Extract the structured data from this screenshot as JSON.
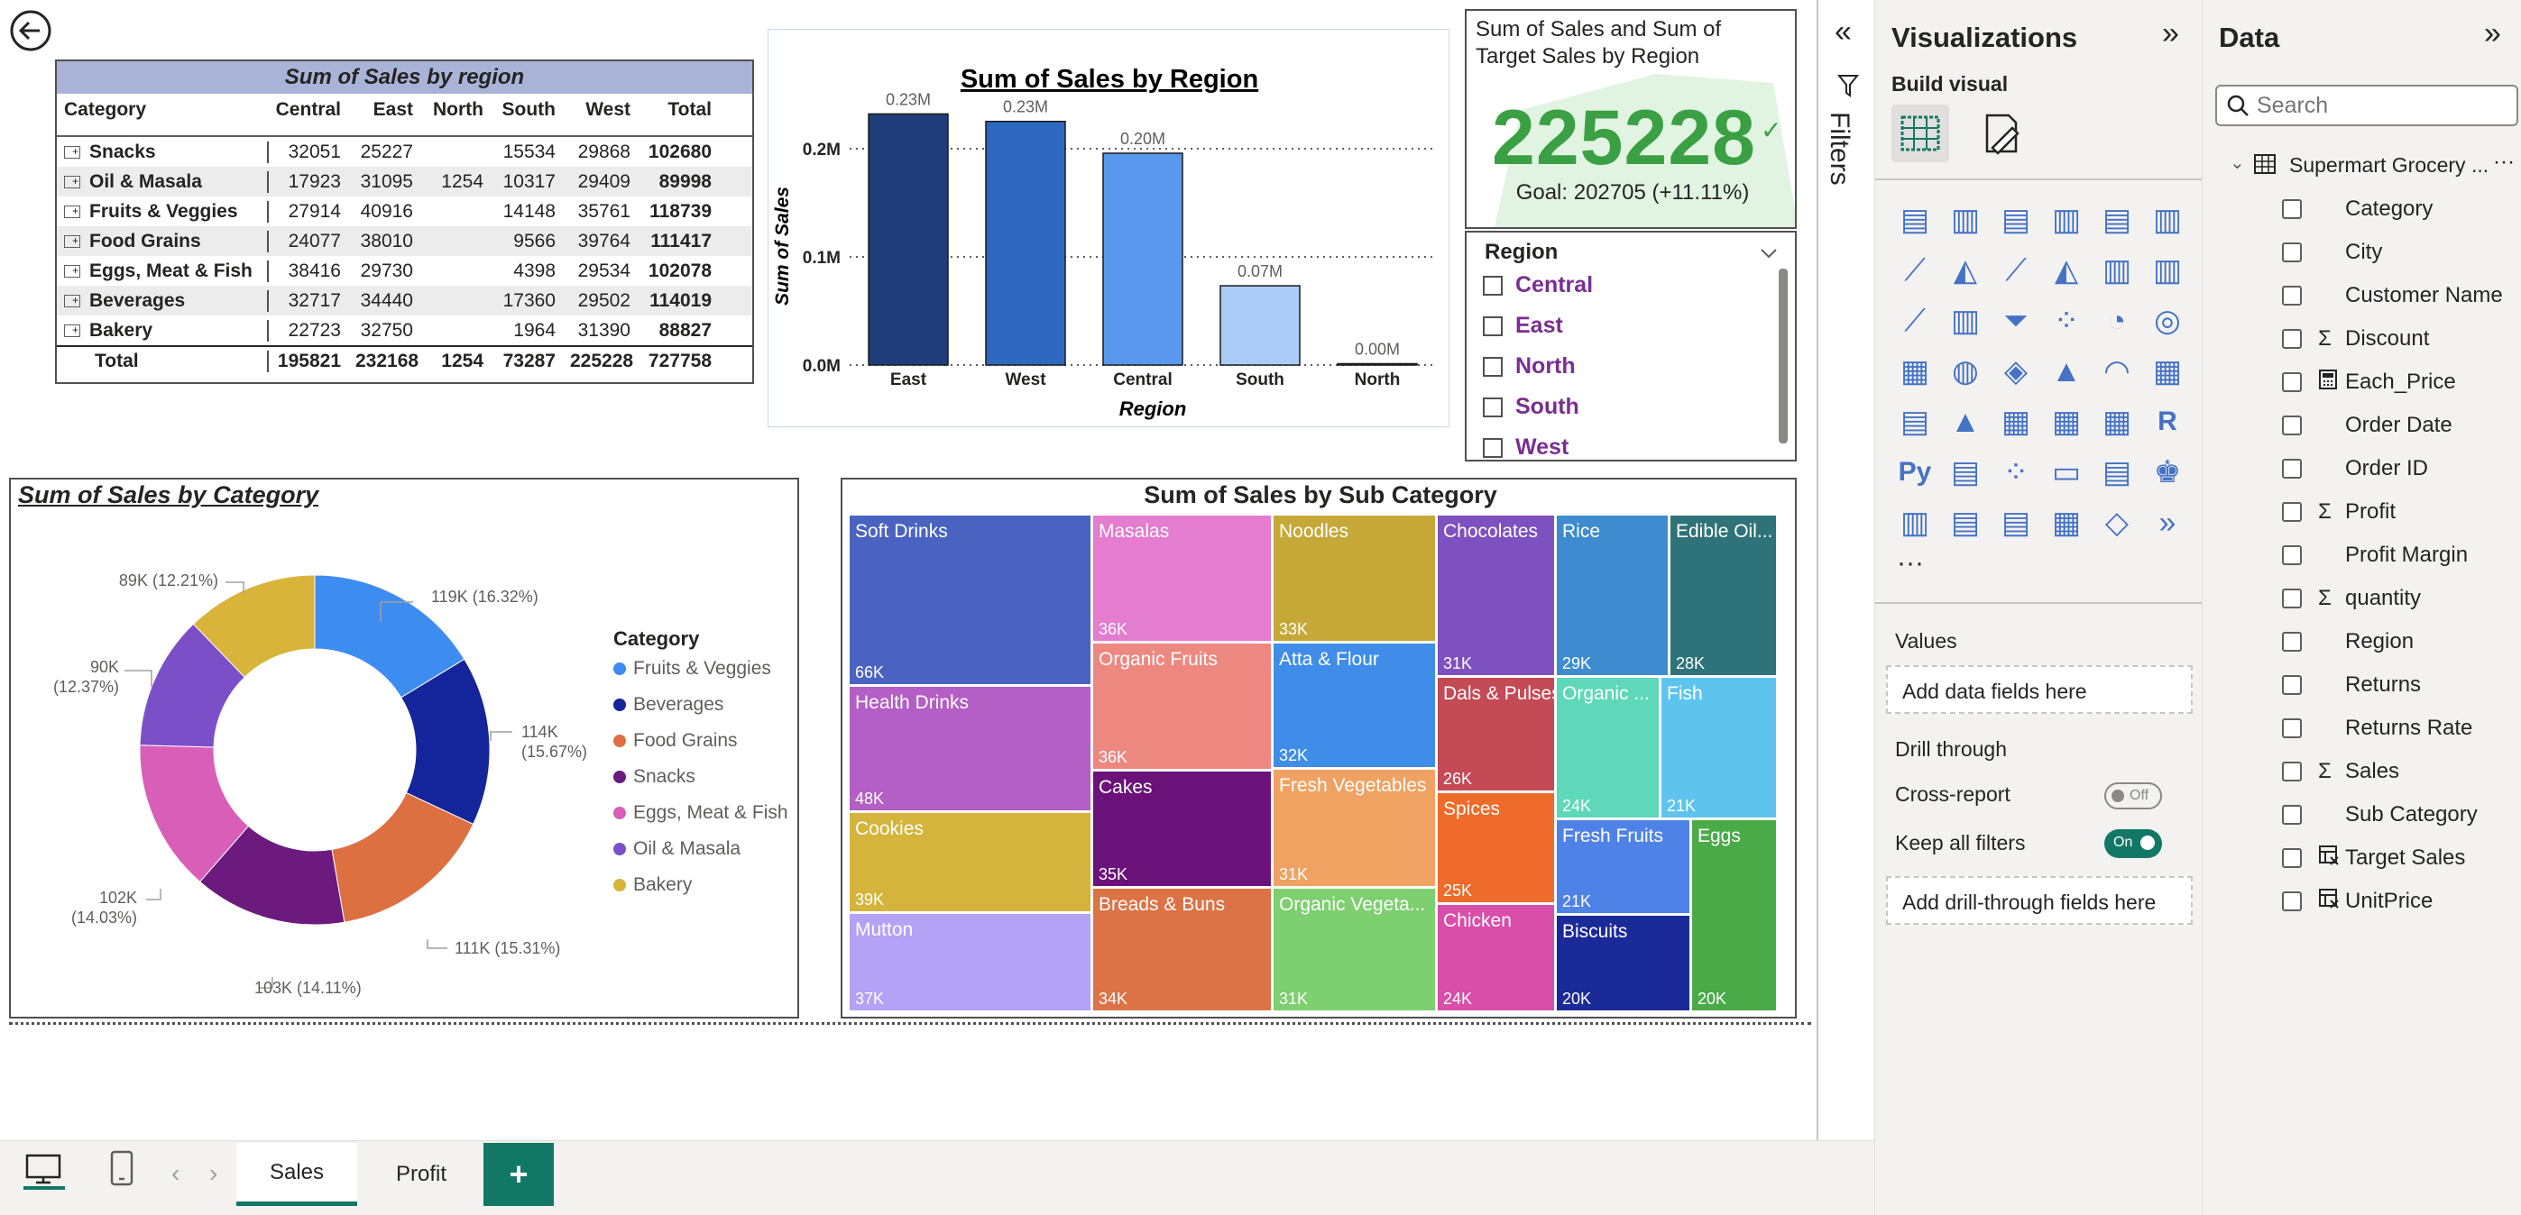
{
  "matrix": {
    "title": "Sum of Sales by region",
    "headers": [
      "Category",
      "Central",
      "East",
      "North",
      "South",
      "West",
      "Total"
    ],
    "rows": [
      [
        "Snacks",
        "32051",
        "25227",
        "",
        "15534",
        "29868",
        "102680"
      ],
      [
        "Oil & Masala",
        "17923",
        "31095",
        "1254",
        "10317",
        "29409",
        "89998"
      ],
      [
        "Fruits & Veggies",
        "27914",
        "40916",
        "",
        "14148",
        "35761",
        "118739"
      ],
      [
        "Food Grains",
        "24077",
        "38010",
        "",
        "9566",
        "39764",
        "111417"
      ],
      [
        "Eggs, Meat & Fish",
        "38416",
        "29730",
        "",
        "4398",
        "29534",
        "102078"
      ],
      [
        "Beverages",
        "32717",
        "34440",
        "",
        "17360",
        "29502",
        "114019"
      ],
      [
        "Bakery",
        "22723",
        "32750",
        "",
        "1964",
        "31390",
        "88827"
      ]
    ],
    "total": [
      "Total",
      "195821",
      "232168",
      "1254",
      "73287",
      "225228",
      "727758"
    ],
    "expand_symbol": "+"
  },
  "region_chart": {
    "title": "Sum of Sales by Region",
    "xlabel": "Region",
    "ylabel": "Sum of Sales",
    "yticks": [
      "0.0M",
      "0.1M",
      "0.2M"
    ]
  },
  "kpi": {
    "title": "Sum of Sales and Sum of Target Sales by Region",
    "value": "225228",
    "check": "✓",
    "goal": "Goal: 202705 (+11.11%)"
  },
  "slicer": {
    "title": "Region",
    "items": [
      "Central",
      "East",
      "North",
      "South",
      "West"
    ]
  },
  "category_chart": {
    "title": "Sum of Sales by Category",
    "legend_title": "Category",
    "labels": [
      "119K (16.32%)",
      "114K",
      "(15.67%)",
      "111K (15.31%)",
      "103K (14.11%)",
      "102K",
      "(14.03%)",
      "90K",
      "(12.37%)",
      "89K (12.21%)"
    ]
  },
  "treemap": {
    "title": "Sum of Sales by Sub Category",
    "cells": [
      {
        "name": "Soft Drinks",
        "value": "66K",
        "color": "#4b63c0"
      },
      {
        "name": "Health Drinks",
        "value": "48K",
        "color": "#b35fc5"
      },
      {
        "name": "Cookies",
        "value": "39K",
        "color": "#d4b43c"
      },
      {
        "name": "Mutton",
        "value": "37K",
        "color": "#b3a2f5"
      },
      {
        "name": "Masalas",
        "value": "36K",
        "color": "#e47ccf"
      },
      {
        "name": "Organic Fruits",
        "value": "36K",
        "color": "#ec8880"
      },
      {
        "name": "Cakes",
        "value": "35K",
        "color": "#6a1279"
      },
      {
        "name": "Breads & Buns",
        "value": "34K",
        "color": "#db7346"
      },
      {
        "name": "Noodles",
        "value": "33K",
        "color": "#c5a838"
      },
      {
        "name": "Atta & Flour",
        "value": "32K",
        "color": "#3f8de8"
      },
      {
        "name": "Fresh Vegetables",
        "value": "31K",
        "color": "#efa262"
      },
      {
        "name": "Organic Vegeta...",
        "value": "31K",
        "color": "#7ecf6f"
      },
      {
        "name": "Chocolates",
        "value": "31K",
        "color": "#7e51c0"
      },
      {
        "name": "Dals & Pulses",
        "value": "26K",
        "color": "#c44a55"
      },
      {
        "name": "Spices",
        "value": "25K",
        "color": "#ee6b2b"
      },
      {
        "name": "Chicken",
        "value": "24K",
        "color": "#d84ea8"
      },
      {
        "name": "Rice",
        "value": "29K",
        "color": "#3e8ccf"
      },
      {
        "name": "Organic ...",
        "value": "24K",
        "color": "#5ed8b8"
      },
      {
        "name": "Fresh Fruits",
        "value": "21K",
        "color": "#4f82e6"
      },
      {
        "name": "Biscuits",
        "value": "20K",
        "color": "#1a2a99"
      },
      {
        "name": "Edible Oil...",
        "value": "28K",
        "color": "#2e7379"
      },
      {
        "name": "Fish",
        "value": "21K",
        "color": "#5ec4ee"
      },
      {
        "name": "Eggs",
        "value": "20K",
        "color": "#4aaa48"
      }
    ]
  },
  "chart_data": [
    {
      "type": "bar",
      "title": "Sum of Sales by Region",
      "xlabel": "Region",
      "ylabel": "Sum of Sales",
      "categories": [
        "East",
        "West",
        "Central",
        "South",
        "North"
      ],
      "values": [
        232168,
        225228,
        195821,
        73287,
        1254
      ],
      "data_labels": [
        "0.23M",
        "0.23M",
        "0.20M",
        "0.07M",
        "0.00M"
      ],
      "colors": [
        "#1f3d7a",
        "#2e68c0",
        "#5a98ee",
        "#aaccf7",
        "#d8e6f7"
      ],
      "ylim": [
        0,
        250000
      ],
      "grid": true
    },
    {
      "type": "pie",
      "title": "Sum of Sales by Category",
      "donut": true,
      "legend_position": "right",
      "categories": [
        "Fruits & Veggies",
        "Beverages",
        "Food Grains",
        "Snacks",
        "Eggs, Meat & Fish",
        "Oil & Masala",
        "Bakery"
      ],
      "values": [
        118739,
        114019,
        111417,
        102680,
        102078,
        89998,
        88827
      ],
      "colors": [
        "#3d8cf0",
        "#14249a",
        "#dd7040",
        "#6c1a7e",
        "#d85eb8",
        "#7b4fc8",
        "#d8b43a"
      ]
    }
  ],
  "bottom": {
    "tabs": [
      "Sales",
      "Profit"
    ],
    "add": "+",
    "prev": "‹",
    "next": "›"
  },
  "filters": {
    "label": "Filters",
    "collapse": "«"
  },
  "viz_pane": {
    "title": "Visualizations",
    "expand": "»",
    "build_visual": "Build visual",
    "more": "···",
    "values_label": "Values",
    "add_data": "Add data fields here",
    "drill_through": "Drill through",
    "cross_report": "Cross-report",
    "cross_report_state": "Off",
    "keep_filters": "Keep all filters",
    "keep_filters_state": "On",
    "add_drill": "Add drill-through fields here"
  },
  "data_pane": {
    "title": "Data",
    "expand": "»",
    "search_placeholder": "Search",
    "table_name": "Supermart Grocery ...",
    "table_more": "···",
    "fields": [
      {
        "name": "Category",
        "icon": ""
      },
      {
        "name": "City",
        "icon": ""
      },
      {
        "name": "Customer Name",
        "icon": ""
      },
      {
        "name": "Discount",
        "icon": "Σ"
      },
      {
        "name": "Each_Price",
        "icon": "calc"
      },
      {
        "name": "Order Date",
        "icon": ""
      },
      {
        "name": "Order ID",
        "icon": ""
      },
      {
        "name": "Profit",
        "icon": "Σ"
      },
      {
        "name": "Profit Margin",
        "icon": ""
      },
      {
        "name": "quantity",
        "icon": "Σ"
      },
      {
        "name": "Region",
        "icon": ""
      },
      {
        "name": "Returns",
        "icon": ""
      },
      {
        "name": "Returns Rate",
        "icon": ""
      },
      {
        "name": "Sales",
        "icon": "Σ"
      },
      {
        "name": "Sub Category",
        "icon": ""
      },
      {
        "name": "Target Sales",
        "icon": "measure"
      },
      {
        "name": "UnitPrice",
        "icon": "measure"
      }
    ]
  }
}
